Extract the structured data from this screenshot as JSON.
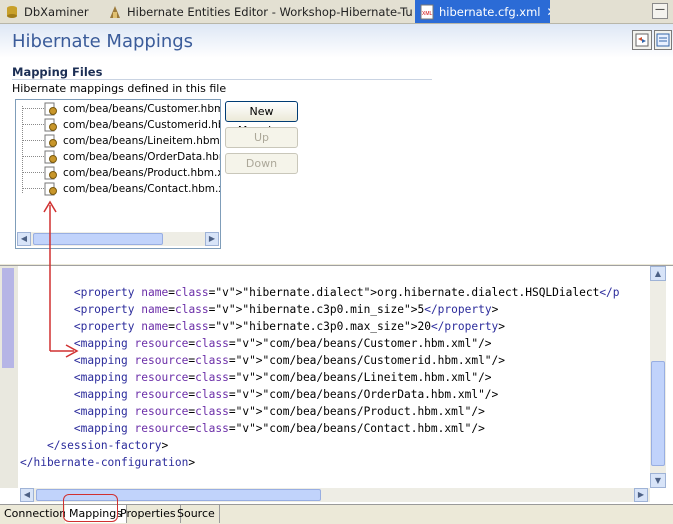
{
  "tabs": [
    {
      "label": "DbXaminer",
      "active": false
    },
    {
      "label": "Hibernate Entities Editor - Workshop-Hibernate-Tutorial",
      "active": false
    },
    {
      "label": "hibernate.cfg.xml",
      "active": true,
      "close": "✕"
    }
  ],
  "window_buttons": [
    "—"
  ],
  "editor": {
    "title": "Hibernate Mappings",
    "section_title": "Mapping Files",
    "section_desc": "Hibernate mappings defined in this file",
    "mapping_files": [
      "com/bea/beans/Customer.hbm.xml",
      "com/bea/beans/Customerid.hbm.xml",
      "com/bea/beans/Lineitem.hbm.xml",
      "com/bea/beans/OrderData.hbm.xml",
      "com/bea/beans/Product.hbm.xml",
      "com/bea/beans/Contact.hbm.xml"
    ],
    "buttons": {
      "new_mapping": "New Mapping",
      "up": "Up",
      "down": "Down"
    }
  },
  "source": {
    "lines": [
      {
        "indent": "        ",
        "text": "<property name=\"hibernate.dialect\">org.hibernate.dialect.HSQLDialect</p"
      },
      {
        "indent": "        ",
        "text": "<property name=\"hibernate.c3p0.min_size\">5</property>"
      },
      {
        "indent": "        ",
        "text": "<property name=\"hibernate.c3p0.max_size\">20</property>"
      },
      {
        "indent": "        ",
        "text": "<mapping resource=\"com/bea/beans/Customer.hbm.xml\"/>"
      },
      {
        "indent": "        ",
        "text": "<mapping resource=\"com/bea/beans/Customerid.hbm.xml\"/>"
      },
      {
        "indent": "        ",
        "text": "<mapping resource=\"com/bea/beans/Lineitem.hbm.xml\"/>"
      },
      {
        "indent": "        ",
        "text": "<mapping resource=\"com/bea/beans/OrderData.hbm.xml\"/>"
      },
      {
        "indent": "        ",
        "text": "<mapping resource=\"com/bea/beans/Product.hbm.xml\"/>"
      },
      {
        "indent": "        ",
        "text": "<mapping resource=\"com/bea/beans/Contact.hbm.xml\"/>"
      },
      {
        "indent": "    ",
        "text": "</session-factory>"
      },
      {
        "indent": "",
        "text": "</hibernate-configuration>"
      }
    ]
  },
  "bottom_tabs": [
    {
      "label": "Connection",
      "active": false
    },
    {
      "label": "Mappings",
      "active": true
    },
    {
      "label": "Properties",
      "active": false
    },
    {
      "label": "Source",
      "active": false
    }
  ],
  "colors": {
    "title": "#3b5c9a",
    "active_tab": "#2b6bd6",
    "annotation": "#d03030",
    "xml_tag": "#2c2c9c",
    "xml_attr": "#6b2ea8",
    "xml_value": "#2a7a2a"
  },
  "icons": {
    "dbxaminer": "database-icon",
    "entities_editor": "hibernate-icon",
    "xml_file": "xml-file-icon",
    "mapping_file": "hbm-file-icon"
  }
}
